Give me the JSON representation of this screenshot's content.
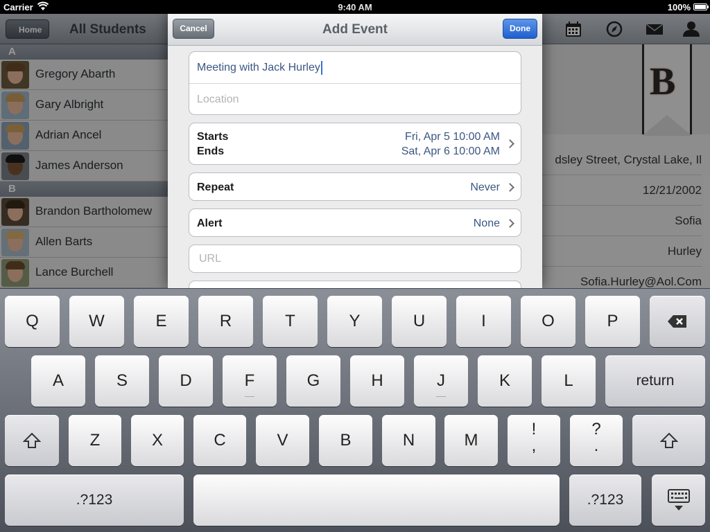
{
  "status_bar": {
    "carrier": "Carrier",
    "time": "9:40 AM",
    "battery": "100%"
  },
  "left_pane": {
    "back_label": "Home",
    "title": "All Students",
    "sections": [
      {
        "letter": "A",
        "students": [
          "Gregory Abarth",
          "Gary Albright",
          "Adrian Ancel",
          "James Anderson"
        ]
      },
      {
        "letter": "B",
        "students": [
          "Brandon Bartholomew",
          "Allen Barts",
          "Lance Burchell"
        ]
      }
    ]
  },
  "right_pane": {
    "badge_letter": "B",
    "toolbar_icons": [
      "calendar-icon",
      "compass-icon",
      "mail-icon",
      "person-icon"
    ],
    "info_rows": [
      "dsley Street, Crystal Lake, Il",
      "12/21/2002",
      "Sofia",
      "Hurley",
      "Sofia.Hurley@Aol.Com"
    ]
  },
  "modal": {
    "title": "Add Event",
    "cancel_label": "Cancel",
    "done_label": "Done",
    "title_field": {
      "value": "Meeting with Jack Hurley"
    },
    "location_field": {
      "placeholder": "Location"
    },
    "starts_label": "Starts",
    "ends_label": "Ends",
    "starts_value": "Fri, Apr 5  10:00 AM",
    "ends_value": "Sat, Apr 6  10:00 AM",
    "repeat_label": "Repeat",
    "repeat_value": "Never",
    "alert_label": "Alert",
    "alert_value": "None",
    "url_field": {
      "placeholder": "URL"
    }
  },
  "keyboard": {
    "row1": [
      "Q",
      "W",
      "E",
      "R",
      "T",
      "Y",
      "U",
      "I",
      "O",
      "P"
    ],
    "row2": [
      "A",
      "S",
      "D",
      "F",
      "G",
      "H",
      "J",
      "K",
      "L"
    ],
    "row3": [
      "Z",
      "X",
      "C",
      "V",
      "B",
      "N",
      "M"
    ],
    "return_label": "return",
    "exclaim_top": "!",
    "exclaim_bot": ",",
    "question_top": "?",
    "question_bot": ".",
    "numbers_label": ".?123"
  },
  "colors": {
    "accent": "#1f5fcf",
    "field_text": "#3a5684"
  }
}
